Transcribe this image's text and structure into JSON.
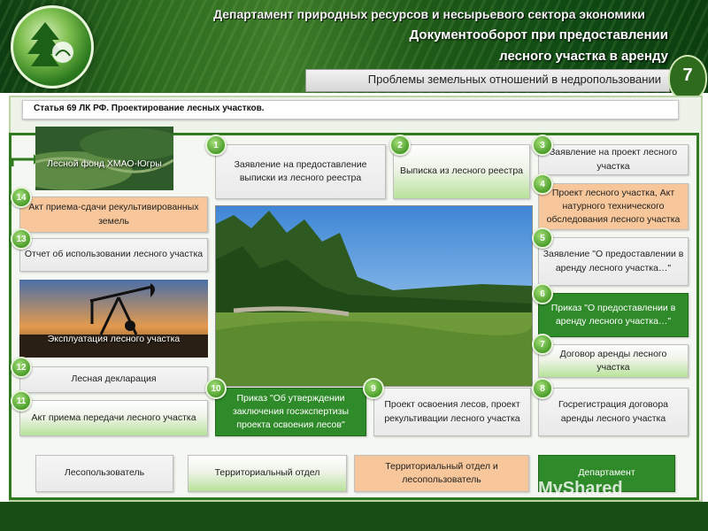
{
  "header": {
    "department": "Департамент природных ресурсов и несырьевого сектора экономики",
    "title_line1": "Документооборот при предоставлении",
    "title_line2": "лесного участка в аренду",
    "subtitle": "Проблемы земельных отношений в недропользовании",
    "page_number": "7"
  },
  "article": "Статья 69 ЛК РФ. Проектирование лесных участков.",
  "photo_labels": {
    "forest_fund": "Лесной фонд ХМАО-Югры",
    "exploitation": "Эксплуатация лесного участка"
  },
  "steps": [
    {
      "num": "1",
      "text": "Заявление на предоставление выписки из лесного реестра"
    },
    {
      "num": "2",
      "text": "Выписка из лесного реестра"
    },
    {
      "num": "3",
      "text": "Заявление на проект лесного участка"
    },
    {
      "num": "4",
      "text": "Проект лесного участка, Акт натурного технического обследования лесного участка"
    },
    {
      "num": "5",
      "text": "Заявление \"О предоставлении в аренду лесного участка…\""
    },
    {
      "num": "6",
      "text": "Приказ \"О предоставлении в аренду лесного участка…\""
    },
    {
      "num": "7",
      "text": "Договор аренды лесного участка"
    },
    {
      "num": "8",
      "text": "Госрегистрация договора аренды лесного участка"
    },
    {
      "num": "9",
      "text": "Проект освоения лесов, проект рекультивации лесного участка"
    },
    {
      "num": "10",
      "text": "Приказ \"Об утверждении заключения госэкспертизы проекта освоения лесов\""
    },
    {
      "num": "11",
      "text": "Акт приема передачи лесного участка"
    },
    {
      "num": "12",
      "text": "Лесная декларация"
    },
    {
      "num": "13",
      "text": "Отчет об использовании лесного участка"
    },
    {
      "num": "14",
      "text": "Акт приема-сдачи рекультивированных земель"
    }
  ],
  "legend": [
    {
      "label": "Лесопользователь",
      "color": "#eeeeee"
    },
    {
      "label": "Территориальный отдел",
      "color": "#c9ebb0"
    },
    {
      "label": "Территориальный отдел и лесопользователь",
      "color": "#f7c79b"
    },
    {
      "label": "Департамент",
      "color": "#2f8a2a"
    }
  ],
  "watermark": "MyShared"
}
